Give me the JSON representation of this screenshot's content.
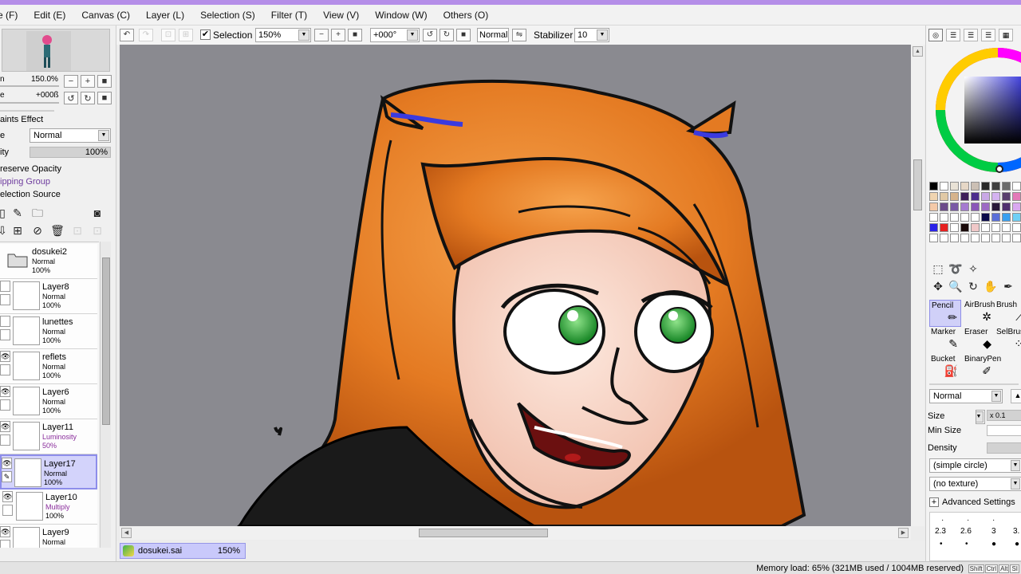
{
  "menu": [
    {
      "label": "e (F)"
    },
    {
      "label": "Edit (E)"
    },
    {
      "label": "Canvas (C)"
    },
    {
      "label": "Layer (L)"
    },
    {
      "label": "Selection (S)"
    },
    {
      "label": "Filter (T)"
    },
    {
      "label": "View (V)"
    },
    {
      "label": "Window (W)"
    },
    {
      "label": "Others (O)"
    }
  ],
  "navigator": {
    "zoom_label": "n",
    "zoom_value": "150.0%",
    "rotate_label": "e",
    "rotate_value": "+000ß"
  },
  "layer_props": {
    "effect_label": "aints Effect",
    "mode_label": "e",
    "mode_value": "Normal",
    "opacity_label": "ity",
    "opacity_value": "100%",
    "preserve_opacity": "reserve Opacity",
    "clipping_group": "ipping Group",
    "selection_source": "election Source"
  },
  "layers": [
    {
      "name": "dosukei2",
      "mode": "Normal",
      "opacity": "100%",
      "folder": true
    },
    {
      "name": "Layer8",
      "mode": "Normal",
      "opacity": "100%"
    },
    {
      "name": "lunettes",
      "mode": "Normal",
      "opacity": "100%"
    },
    {
      "name": "reflets",
      "mode": "Normal",
      "opacity": "100%"
    },
    {
      "name": "Layer6",
      "mode": "Normal",
      "opacity": "100%"
    },
    {
      "name": "Layer11",
      "mode": "Luminosity",
      "opacity": "50%"
    },
    {
      "name": "Layer17",
      "mode": "Normal",
      "opacity": "100%"
    },
    {
      "name": "Layer10",
      "mode": "Multiply",
      "opacity": "100%"
    },
    {
      "name": "Layer9",
      "mode": "Normal",
      "opacity": ""
    }
  ],
  "toolbar": {
    "selection_label": "Selection",
    "zoom": "150%",
    "rotation": "+000°",
    "blend_mode": "Normal",
    "stabilizer_label": "Stabilizer",
    "stabilizer_value": "10"
  },
  "document_tab": {
    "name": "dosukei.sai",
    "zoom": "150%"
  },
  "tools": {
    "row1": [
      "Pencil",
      "AirBrush",
      "Brush"
    ],
    "row2": [
      "Marker",
      "Eraser",
      "SelBrush"
    ],
    "row3": [
      "Bucket",
      "BinaryPen"
    ]
  },
  "brush": {
    "blend_mode": "Normal",
    "size_label": "Size",
    "size_multiplier": "x 0.1",
    "min_size_label": "Min Size",
    "density_label": "Density",
    "shape": "(simple circle)",
    "texture": "(no texture)",
    "advanced_label": "Advanced Settings",
    "size_presets": [
      "2.3",
      "2.6",
      "3",
      "3."
    ]
  },
  "colors": {
    "accent": "#b58ee8",
    "selection_bg": "#d3d3fb",
    "canvas_bg": "#8a8a90",
    "swatches": [
      "#000000",
      "#ffffff",
      "#e9e2d6",
      "#e6d7c6",
      "#cbbfb4",
      "#2a2a2a",
      "#3f3f3f",
      "#6b6b6b",
      "#ffffff",
      "#ffffff",
      "#e61c1c",
      "#f0d4b0",
      "#e1c9a5",
      "#d6b38c",
      "#3e1f5a",
      "#4d2e8e",
      "#c9a8e6",
      "#d4b3f0",
      "#5a3f6e",
      "#e37ab8",
      "#e86fb0",
      "#ffffff",
      "#f4c9a8",
      "#6b4a8a",
      "#7a5aa6",
      "#a57ad0",
      "#8a56b8",
      "#9d6bc4",
      "#2a1a3a",
      "#503070",
      "#d9a8f0",
      "#e3c6f5",
      "#ffffff",
      "#ffffff",
      "#ffffff",
      "#ffffff",
      "#ffffff",
      "#ffffff",
      "#0a0a4a",
      "#5a6fd8",
      "#39a0f0",
      "#6fd0f5",
      "#9ad8f0",
      "#ffffff",
      "#2a22e8",
      "#e62020",
      "#ffffff",
      "#1a0a0a",
      "#f0c8c8",
      "#ffffff",
      "#ffffff",
      "#ffffff",
      "#ffffff",
      "#ffffff",
      "#ffffff",
      "#ffffff",
      "#ffffff",
      "#ffffff",
      "#ffffff",
      "#ffffff",
      "#ffffff",
      "#ffffff",
      "#ffffff",
      "#ffffff",
      "#ffffff",
      "#ffffff"
    ]
  },
  "status": {
    "memory": "Memory load: 65% (321MB used / 1004MB reserved)",
    "keys": [
      "Shift",
      "Ctrl",
      "Alt",
      "SI"
    ]
  }
}
